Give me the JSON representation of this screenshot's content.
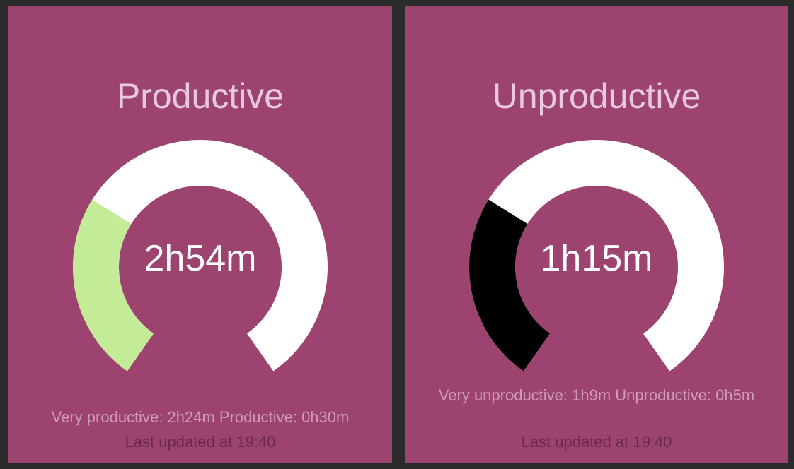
{
  "colors": {
    "background": "#2b2b2b",
    "widget": "#9c4370",
    "track": "#ffffff",
    "productive_fill": "#c3eb98",
    "unproductive_fill": "#000000"
  },
  "widgets": [
    {
      "title": "Productive",
      "value": "2h54m",
      "gauge_fraction": 0.3,
      "more_info": "Very productive: 2h24m Productive: 0h30m",
      "updated_at": "Last updated at 19:40"
    },
    {
      "title": "Unproductive",
      "value": "1h15m",
      "gauge_fraction": 0.3,
      "more_info": "Very unproductive: 1h9m Unproductive: 0h5m",
      "updated_at": "Last updated at 19:40"
    }
  ]
}
